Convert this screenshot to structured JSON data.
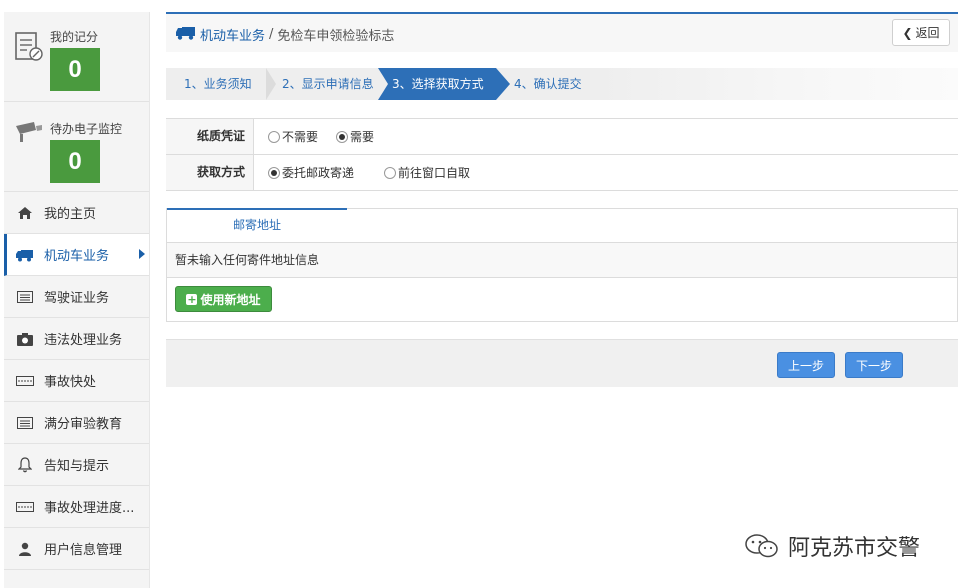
{
  "sidebar": {
    "stats": [
      {
        "label": "我的记分",
        "count": "0",
        "icon": "document-edit-icon"
      },
      {
        "label": "待办电子监控",
        "count": "0",
        "icon": "surveillance-camera-icon"
      }
    ],
    "items": [
      {
        "label": "我的主页",
        "icon": "home-icon"
      },
      {
        "label": "机动车业务",
        "icon": "truck-icon",
        "active": true
      },
      {
        "label": "驾驶证业务",
        "icon": "id-card-icon"
      },
      {
        "label": "违法处理业务",
        "icon": "camera-icon"
      },
      {
        "label": "事故快处",
        "icon": "ticket-icon"
      },
      {
        "label": "满分审验教育",
        "icon": "list-card-icon"
      },
      {
        "label": "告知与提示",
        "icon": "bell-icon"
      },
      {
        "label": "事故处理进度...",
        "icon": "ticket-icon"
      },
      {
        "label": "用户信息管理",
        "icon": "user-icon"
      }
    ]
  },
  "header": {
    "section": "机动车业务",
    "separator": "/",
    "page": "免检车申领检验标志",
    "back_label": "返回"
  },
  "steps": [
    {
      "label": "1、业务须知"
    },
    {
      "label": "2、显示申请信息"
    },
    {
      "label": "3、选择获取方式",
      "active": true
    },
    {
      "label": "4、确认提交"
    }
  ],
  "form": {
    "paper_label": "纸质凭证",
    "paper_options": [
      {
        "label": "不需要",
        "checked": false
      },
      {
        "label": "需要",
        "checked": true
      }
    ],
    "method_label": "获取方式",
    "method_options": [
      {
        "label": "委托邮政寄递",
        "checked": true
      },
      {
        "label": "前往窗口自取",
        "checked": false
      }
    ]
  },
  "address": {
    "tab_label": "邮寄地址",
    "empty_text": "暂未输入任何寄件地址信息",
    "new_button": "使用新地址"
  },
  "footer": {
    "prev_label": "上一步",
    "next_label": "下一步"
  },
  "watermark": {
    "text": "阿克苏市交警",
    "icon": "wechat-icon"
  },
  "colors": {
    "accent": "#2d6fb7",
    "count_bg": "#4a9a3e",
    "green_button": "#4cae4c",
    "blue_button": "#4a90e2"
  }
}
